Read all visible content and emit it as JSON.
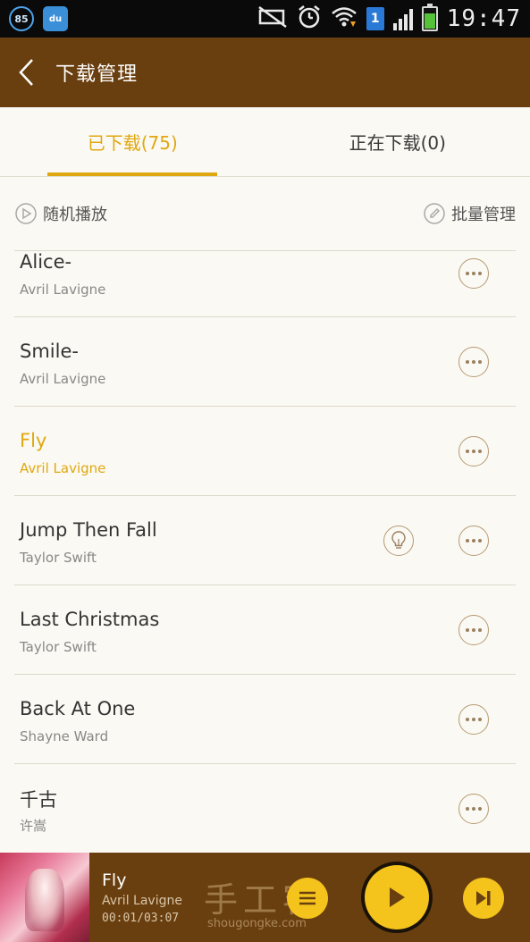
{
  "status_bar": {
    "badge_number": "85",
    "app_icon_label": "du",
    "sim_slot": "1",
    "time": "19:47",
    "icons": [
      "notification-off-icon",
      "alarm-icon",
      "wifi-icon",
      "signal-icon",
      "battery-icon"
    ]
  },
  "header": {
    "title": "下载管理"
  },
  "tabs": [
    {
      "label": "已下载(75)",
      "active": true
    },
    {
      "label": "正在下载(0)",
      "active": false
    }
  ],
  "actions": {
    "shuffle_label": "随机播放",
    "batch_label": "批量管理"
  },
  "songs": [
    {
      "title": "Alice-",
      "artist": "Avril Lavigne"
    },
    {
      "title": "Smile-",
      "artist": "Avril Lavigne"
    },
    {
      "title": "Fly",
      "artist": "Avril Lavigne",
      "playing": true
    },
    {
      "title": "Jump Then Fall",
      "artist": "Taylor Swift",
      "has_tip": true
    },
    {
      "title": "Last Christmas",
      "artist": "Taylor Swift"
    },
    {
      "title": "Back At One",
      "artist": "Shayne Ward"
    },
    {
      "title": "千古",
      "artist": "许嵩"
    }
  ],
  "player": {
    "title": "Fly",
    "artist": "Avril Lavigne",
    "time": "00:01/03:07",
    "watermark": "手工客",
    "watermark_url": "shougongke.com"
  },
  "colors": {
    "accent": "#e0a810",
    "brand_brown": "#6a3f10",
    "button_yellow": "#f4c31c"
  }
}
